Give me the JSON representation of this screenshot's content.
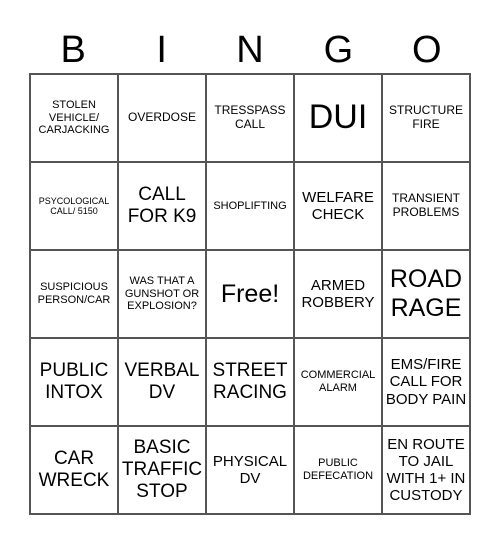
{
  "header": [
    "B",
    "I",
    "N",
    "G",
    "O"
  ],
  "cells": [
    {
      "text": "STOLEN VEHICLE/ CARJACKING",
      "size": "s-s"
    },
    {
      "text": "OVERDOSE",
      "size": "s-s2"
    },
    {
      "text": "TRESSPASS CALL",
      "size": "s-s2"
    },
    {
      "text": "DUI",
      "size": "s-xxl"
    },
    {
      "text": "STRUCTURE FIRE",
      "size": "s-s2"
    },
    {
      "text": "PSYCOLOGICAL CALL/ 5150",
      "size": "s-xs"
    },
    {
      "text": "CALL FOR K9",
      "size": "s-l"
    },
    {
      "text": "SHOPLIFTING",
      "size": "s-s"
    },
    {
      "text": "WELFARE CHECK",
      "size": "s-m"
    },
    {
      "text": "TRANSIENT PROBLEMS",
      "size": "s-s2"
    },
    {
      "text": "SUSPICIOUS PERSON/CAR",
      "size": "s-s"
    },
    {
      "text": "WAS THAT A GUNSHOT OR EXPLOSION?",
      "size": "s-s"
    },
    {
      "text": "Free!",
      "size": "s-xl"
    },
    {
      "text": "ARMED ROBBERY",
      "size": "s-m"
    },
    {
      "text": "ROAD RAGE",
      "size": "s-xl"
    },
    {
      "text": "PUBLIC INTOX",
      "size": "s-l"
    },
    {
      "text": "VERBAL DV",
      "size": "s-l"
    },
    {
      "text": "STREET RACING",
      "size": "s-l"
    },
    {
      "text": "COMMERCIAL ALARM",
      "size": "s-s"
    },
    {
      "text": "EMS/FIRE CALL FOR BODY PAIN",
      "size": "s-m"
    },
    {
      "text": "CAR WRECK",
      "size": "s-l"
    },
    {
      "text": "BASIC TRAFFIC STOP",
      "size": "s-l"
    },
    {
      "text": "PHYSICAL DV",
      "size": "s-m"
    },
    {
      "text": "PUBLIC DEFECATION",
      "size": "s-s"
    },
    {
      "text": "EN ROUTE TO JAIL WITH 1+ IN CUSTODY",
      "size": "s-m"
    }
  ]
}
